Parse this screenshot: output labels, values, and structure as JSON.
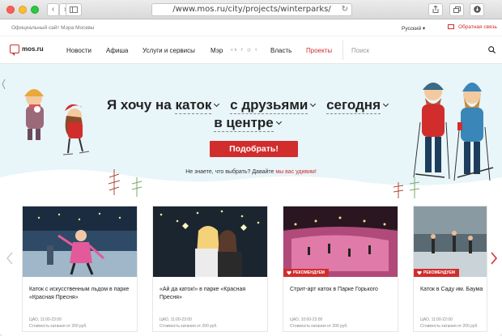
{
  "browser": {
    "url": "/www.mos.ru/city/projects/winterparks/",
    "plus_label": "+"
  },
  "topstrip": {
    "official": "Официальный сайт Мэра Москвы",
    "language": "Русский",
    "feedback": "Обратная связь"
  },
  "nav": {
    "logo": "mos.ru",
    "items": [
      {
        "label": "Новости",
        "active": false
      },
      {
        "label": "Афиша",
        "active": false
      },
      {
        "label": "Услуги и сервисы",
        "active": false
      },
      {
        "label": "Мэр",
        "active": false
      },
      {
        "label": "Власть",
        "active": false
      },
      {
        "label": "Проекты",
        "active": true
      }
    ],
    "social": "vk f ◎ t",
    "search_placeholder": "Поиск"
  },
  "hero": {
    "prefix": "Я хочу на",
    "place": "каток",
    "company": "с друзьями",
    "time": "сегодня",
    "location": "в центре",
    "button": "Подобрать!",
    "hint": "Не знаете, что выбрать? Давайте",
    "hint_link": "мы вас удивим!"
  },
  "cards": [
    {
      "title": "Каток с искусственным льдом в парке «Красная Пресня»",
      "hours": "ЦАО, 11:00-23:00",
      "price": "Стоимость катания от 200 руб.",
      "badge": ""
    },
    {
      "title": "«Ай да каток!» в парке «Красная Пресня»",
      "hours": "ЦАО, 11:00-23:00",
      "price": "Стоимость катания от 200 руб.",
      "badge": ""
    },
    {
      "title": "Стрит-арт каток в Парке Горького",
      "hours": "ЦАО, 10:00-23:00",
      "price": "Стоимость катания от 200 руб.",
      "badge": "РЕКОМЕНДУЕМ"
    },
    {
      "title": "Каток в Саду им. Баума",
      "hours": "ЦАО, 11:00-22:00",
      "price": "Стоимость катания от 200 руб.",
      "badge": "РЕКОМЕНДУЕМ"
    }
  ],
  "colors": {
    "accent": "#d12d2d",
    "hero_bg": "#e8f5f9"
  }
}
